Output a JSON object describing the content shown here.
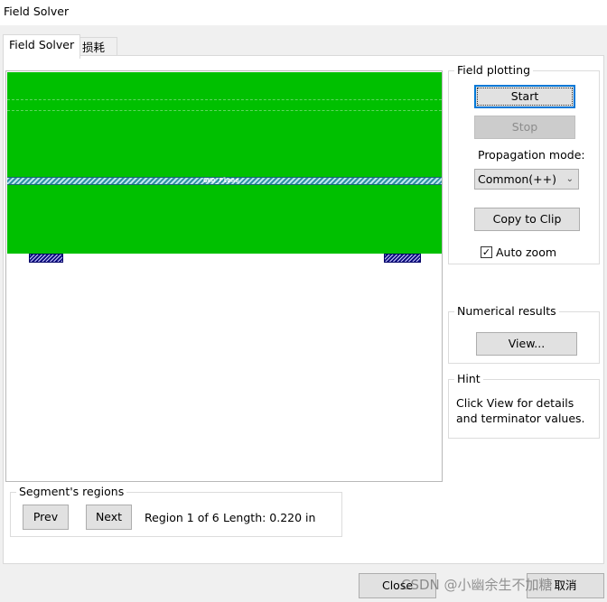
{
  "window": {
    "title": "Field Solver"
  },
  "tabs": [
    {
      "label": "Field Solver",
      "active": true
    },
    {
      "label": "损耗",
      "active": false
    }
  ],
  "viewport": {
    "plane_label": "GND_Plane",
    "colors": {
      "dielectric": "#00c000",
      "plane": "#2f8fa4",
      "trace": "#101080"
    }
  },
  "field_plotting": {
    "legend": "Field plotting",
    "start_label": "Start",
    "stop_label": "Stop",
    "propagation_label": "Propagation mode:",
    "propagation_value": "Common(++)",
    "copy_label": "Copy to Clip",
    "auto_zoom_label": "Auto zoom",
    "auto_zoom_checked": true
  },
  "numerical": {
    "legend": "Numerical results",
    "view_label": "View..."
  },
  "hint": {
    "legend": "Hint",
    "text": "Click View for details and terminator values."
  },
  "segments": {
    "legend": "Segment's regions",
    "prev_label": "Prev",
    "next_label": "Next",
    "region_text": "Region 1 of 6",
    "length_text": "Length: 0.220 in"
  },
  "footer": {
    "close_label": "Close",
    "cancel_label": "取消"
  },
  "watermark": "CSDN @小幽余生不加糖"
}
